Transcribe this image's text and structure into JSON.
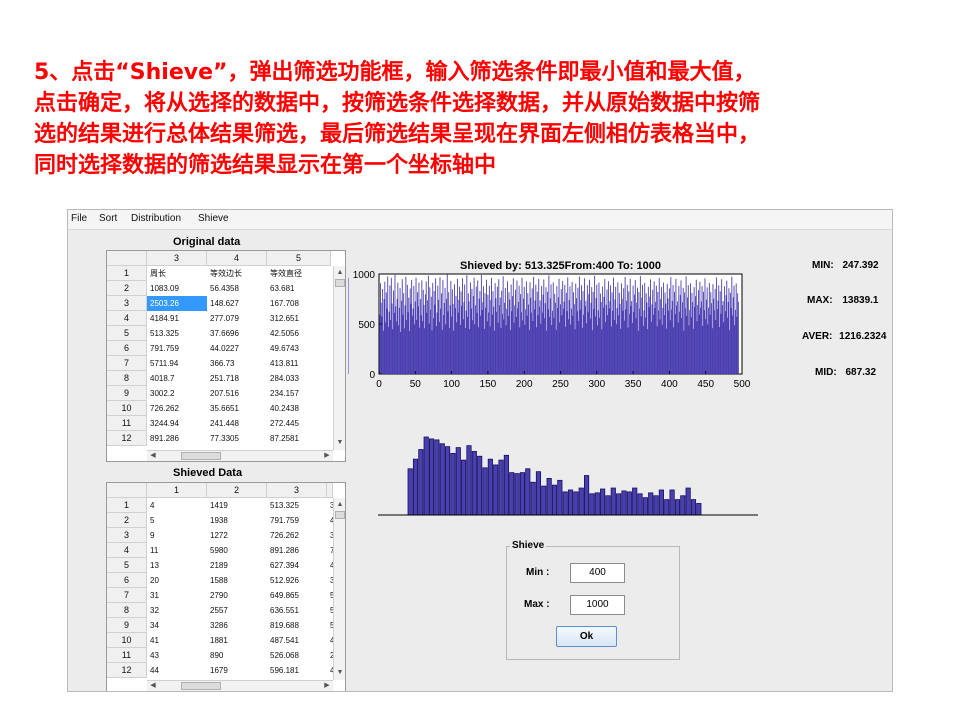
{
  "instruction": {
    "lines": [
      "5、点击“Shieve”，弹出筛选功能框，输入筛选条件即最小值和最大值，",
      "点击确定，将从选择的数据中，按筛选条件选择数据，并从原始数据中按筛",
      "选的结果进行总体结果筛选，最后筛选结果呈现在界面左侧相仿表格当中，",
      "同时选择数据的筛选结果显示在第一个坐标轴中"
    ]
  },
  "menu": [
    "File",
    "Sort",
    "Distribution",
    "Shieve"
  ],
  "original_table": {
    "label": "Original data",
    "columns": [
      "3",
      "4",
      "5"
    ],
    "rows": [
      {
        "n": "1",
        "c": [
          "周长",
          "等效边长",
          "等效直径"
        ]
      },
      {
        "n": "2",
        "c": [
          "1083.09",
          "56.4358",
          "63.681"
        ]
      },
      {
        "n": "3",
        "c": [
          "2503.26",
          "148.627",
          "167.708"
        ]
      },
      {
        "n": "4",
        "c": [
          "4184.91",
          "277.079",
          "312.651"
        ]
      },
      {
        "n": "5",
        "c": [
          "513.325",
          "37.6696",
          "42.5056"
        ]
      },
      {
        "n": "6",
        "c": [
          "791.759",
          "44.0227",
          "49.6743"
        ]
      },
      {
        "n": "7",
        "c": [
          "5711.94",
          "366.73",
          "413.811"
        ]
      },
      {
        "n": "8",
        "c": [
          "4018.7",
          "251.718",
          "284.033"
        ]
      },
      {
        "n": "9",
        "c": [
          "3002.2",
          "207.516",
          "234.157"
        ]
      },
      {
        "n": "10",
        "c": [
          "726.262",
          "35.6651",
          "40.2438"
        ]
      },
      {
        "n": "11",
        "c": [
          "3244.94",
          "241.448",
          "272.445"
        ]
      },
      {
        "n": "12",
        "c": [
          "891.286",
          "77.3305",
          "87.2581"
        ]
      }
    ],
    "selected": {
      "row": 2,
      "col": 0
    }
  },
  "shieved_table": {
    "label": "Shieved Data",
    "columns": [
      "1",
      "2",
      "3"
    ],
    "rows": [
      {
        "n": "1",
        "c": [
          "4",
          "1419",
          "513.325",
          "3"
        ]
      },
      {
        "n": "2",
        "c": [
          "5",
          "1938",
          "791.759",
          "4"
        ]
      },
      {
        "n": "3",
        "c": [
          "9",
          "1272",
          "726.262",
          "3"
        ]
      },
      {
        "n": "4",
        "c": [
          "11",
          "5980",
          "891.286",
          "7"
        ]
      },
      {
        "n": "5",
        "c": [
          "13",
          "2189",
          "627.394",
          "4"
        ]
      },
      {
        "n": "6",
        "c": [
          "20",
          "1588",
          "512.926",
          "3"
        ]
      },
      {
        "n": "7",
        "c": [
          "31",
          "2790",
          "649.865",
          "5"
        ]
      },
      {
        "n": "8",
        "c": [
          "32",
          "2557",
          "636.551",
          "5"
        ]
      },
      {
        "n": "9",
        "c": [
          "34",
          "3286",
          "819.688",
          "5"
        ]
      },
      {
        "n": "10",
        "c": [
          "41",
          "1881",
          "487.541",
          "4"
        ]
      },
      {
        "n": "11",
        "c": [
          "43",
          "890",
          "526.068",
          "2"
        ]
      },
      {
        "n": "12",
        "c": [
          "44",
          "1679",
          "596.181",
          "4"
        ]
      }
    ]
  },
  "stats": [
    {
      "label": "MIN:",
      "value": "247.392"
    },
    {
      "label": "MAX:",
      "value": "13839.1"
    },
    {
      "label": "AVER:",
      "value": "1216.2324"
    },
    {
      "label": "MID:",
      "value": "687.32"
    }
  ],
  "shieve_panel": {
    "title": "Shieve",
    "min_label": "Min :",
    "min_value": "400",
    "max_label": "Max :",
    "max_value": "1000",
    "ok_label": "Ok"
  },
  "colors": {
    "bar": "#4b3fb0",
    "bar_dark": "#1e1a6e",
    "instruction": "#ff0000",
    "selection": "#3399ff"
  },
  "chart_data": [
    {
      "type": "bar",
      "title": "Shieved by: 513.325From:400 To: 1000",
      "xlim": [
        0,
        500
      ],
      "ylim": [
        0,
        1000
      ],
      "xticks": [
        0,
        50,
        100,
        150,
        200,
        250,
        300,
        350,
        400,
        450,
        500
      ],
      "yticks": [
        0,
        500,
        1000
      ],
      "x": [
        1,
        2,
        3,
        4,
        5,
        6,
        7,
        8,
        9,
        10,
        11,
        12,
        13,
        14,
        15,
        16,
        17,
        18,
        19,
        20,
        21,
        22,
        23,
        24,
        25,
        26,
        27,
        28,
        29,
        30,
        31,
        32,
        33,
        34,
        35,
        36,
        37,
        38,
        39,
        40,
        41,
        42,
        43,
        44,
        45,
        46,
        47,
        48,
        49,
        50,
        51,
        52,
        53,
        54,
        55,
        56,
        57,
        58,
        59,
        60,
        61,
        62,
        63,
        64,
        65,
        66,
        67,
        68,
        69,
        70,
        71,
        72,
        73,
        74,
        75,
        76,
        77,
        78,
        79,
        80,
        81,
        82,
        83,
        84,
        85,
        86,
        87,
        88,
        89,
        90,
        91,
        92,
        93,
        94,
        95,
        96,
        97,
        98,
        99,
        100,
        101,
        102,
        103,
        104,
        105,
        106,
        107,
        108,
        109,
        110,
        111,
        112,
        113,
        114,
        115,
        116,
        117,
        118,
        119,
        120,
        121,
        122,
        123,
        124,
        125,
        126,
        127,
        128,
        129,
        130,
        131,
        132,
        133,
        134,
        135,
        136,
        137,
        138,
        139,
        140,
        141,
        142,
        143,
        144,
        145,
        146,
        147,
        148,
        149,
        150,
        151,
        152,
        153,
        154,
        155,
        156,
        157,
        158,
        159,
        160,
        161,
        162,
        163,
        164,
        165,
        166,
        167,
        168,
        169,
        170,
        171,
        172,
        173,
        174,
        175,
        176,
        177,
        178,
        179,
        180,
        181,
        182,
        183,
        184,
        185,
        186,
        187,
        188,
        189,
        190,
        191,
        192,
        193,
        194,
        195,
        196,
        197,
        198,
        199,
        200,
        201,
        202,
        203,
        204,
        205,
        206,
        207,
        208,
        209,
        210,
        211,
        212,
        213,
        214,
        215,
        216,
        217,
        218,
        219,
        220,
        221,
        222,
        223,
        224,
        225,
        226,
        227,
        228,
        229,
        230,
        231,
        232,
        233,
        234,
        235,
        236,
        237,
        238,
        239,
        240,
        241,
        242,
        243,
        244,
        245,
        246,
        247,
        248,
        249,
        250,
        251,
        252,
        253,
        254,
        255,
        256,
        257,
        258,
        259,
        260,
        261,
        262,
        263,
        264,
        265,
        266,
        267,
        268,
        269,
        270,
        271,
        272,
        273,
        274,
        275,
        276,
        277,
        278,
        279,
        280,
        281,
        282,
        283,
        284,
        285,
        286,
        287,
        288,
        289,
        290,
        291,
        292,
        293,
        294,
        295,
        296,
        297,
        298,
        299,
        300,
        301,
        302,
        303,
        304,
        305,
        306,
        307,
        308,
        309,
        310,
        311,
        312,
        313,
        314,
        315,
        316,
        317,
        318,
        319,
        320,
        321,
        322,
        323,
        324,
        325,
        326,
        327,
        328,
        329,
        330,
        331,
        332,
        333,
        334,
        335,
        336,
        337,
        338,
        339,
        340,
        341,
        342,
        343,
        344,
        345,
        346,
        347,
        348,
        349,
        350,
        351,
        352,
        353,
        354,
        355,
        356,
        357,
        358,
        359,
        360,
        361,
        362,
        363,
        364,
        365,
        366,
        367,
        368,
        369,
        370,
        371,
        372,
        373,
        374,
        375,
        376,
        377,
        378,
        379,
        380,
        381,
        382,
        383,
        384,
        385,
        386,
        387,
        388,
        389,
        390,
        391,
        392,
        393,
        394,
        395,
        396,
        397,
        398,
        399,
        400,
        401,
        402,
        403,
        404,
        405,
        406,
        407,
        408,
        409,
        410,
        411,
        412,
        413,
        414,
        415,
        416,
        417,
        418,
        419,
        420,
        421,
        422,
        423,
        424,
        425,
        426,
        427,
        428,
        429,
        430,
        431,
        432,
        433,
        434,
        435,
        436,
        437,
        438,
        439,
        440,
        441,
        442,
        443,
        444,
        445,
        446,
        447,
        448,
        449,
        450,
        451,
        452,
        453,
        454,
        455,
        456,
        457,
        458,
        459,
        460,
        461,
        462,
        463,
        464,
        465,
        466,
        467,
        468,
        469,
        470,
        471,
        472,
        473,
        474,
        475,
        476,
        477,
        478,
        479,
        480,
        481,
        482,
        483,
        484,
        485,
        486,
        487,
        488,
        489,
        490,
        491,
        492,
        493,
        494,
        495
      ],
      "values": [
        592,
        907,
        713,
        575,
        851,
        434,
        749,
        923,
        517,
        816,
        652,
        976,
        471,
        623,
        886,
        540,
        961,
        705,
        448,
        835,
        612,
        991,
        678,
        527,
        752,
        914,
        486,
        663,
        859,
        421,
        733,
        948,
        594,
        809,
        456,
        687,
        972,
        538,
        891,
        617,
        763,
        429,
        855,
        702,
        941,
        583,
        654,
        881,
        497,
        726,
        963,
        542,
        818,
        676,
        914,
        463,
        749,
        587,
        937,
        528,
        842,
        691,
        458,
        796,
        925,
        612,
        737,
        984,
        504,
        867,
        641,
        773,
        436,
        912,
        558,
        829,
        694,
        957,
        478,
        615,
        883,
        742,
        521,
        968,
        654,
        807,
        441,
        939,
        589,
        711,
        862,
        497,
        753,
        994,
        626,
        818,
        462,
        687,
        931,
        574,
        846,
        702,
        433,
        897,
        659,
        781,
        518,
        952,
        614,
        741,
        873,
        492,
        826,
        683,
        958,
        547,
        719,
        895,
        461,
        634,
        988,
        572,
        807,
        726,
        449,
        916,
        653,
        851,
        538,
        779,
        962,
        497,
        687,
        874,
        612,
        936,
        468,
        754,
        829,
        583,
        991,
        641,
        718,
        877,
        452,
        806,
        663,
        943,
        527,
        792,
        615,
        882,
        476,
        739,
        961,
        594,
        827,
        672,
        435,
        908,
        756,
        621,
        873,
        511,
        948,
        689,
        764,
        459,
        834,
        602,
        977,
        546,
        713,
        861,
        487,
        652,
        926,
        579,
        818,
        744,
        439,
        895,
        628,
        779,
        957,
        513,
        686,
        842,
        571,
        934,
        657,
        721,
        884,
        466,
        799,
        617,
        963,
        536,
        752,
        871,
        492,
        647,
        926,
        583,
        808,
        695,
        441,
        917,
        763,
        614,
        856,
        529,
        972,
        648,
        735,
        893,
        467,
        824,
        589,
        951,
        673,
        736,
        502,
        881,
        614,
        793,
        945,
        558,
        709,
        867,
        434,
        823,
        647,
        986,
        571,
        756,
        896,
        489,
        632,
        917,
        557,
        802,
        714,
        443,
        879,
        661,
        768,
        952,
        516,
        697,
        848,
        587,
        931,
        652,
        724,
        891,
        472,
        813,
        629,
        967,
        548,
        741,
        876,
        495,
        654,
        921,
        583,
        817,
        698,
        448,
        904,
        759,
        627,
        862,
        531,
        975,
        643,
        738,
        887,
        461,
        829,
        594,
        956,
        677,
        732,
        508,
        888,
        617,
        797,
        942,
        553,
        712,
        869,
        437,
        821,
        651,
        983,
        574,
        759,
        893,
        486,
        637,
        914,
        561,
        804,
        719,
        446,
        875,
        664,
        771,
        949,
        519,
        693,
        845,
        589,
        928,
        655,
        727,
        887,
        475,
        816,
        633,
        964,
        542,
        746,
        872,
        498,
        658,
        917,
        586,
        812,
        701,
        452,
        906,
        752,
        631,
        858,
        534,
        971,
        647,
        734,
        892,
        464,
        826,
        597,
        953,
        681,
        729,
        511,
        884,
        621,
        794,
        939,
        556,
        715,
        864,
        431,
        819,
        654,
        979,
        577,
        762,
        891,
        483,
        635,
        911,
        564,
        807,
        716,
        449,
        872,
        668,
        774,
        946,
        523,
        697,
        842,
        591,
        925,
        659,
        722,
        883,
        478,
        819,
        636,
        961,
        545,
        749,
        869,
        494,
        661,
        914,
        589,
        815,
        704,
        455,
        901,
        756,
        634,
        855,
        537,
        968,
        645,
        731,
        889,
        467,
        823,
        599,
        951,
        684,
        726,
        514,
        881,
        624,
        791,
        936,
        559,
        718,
        861,
        434,
        816,
        657,
        976,
        581,
        765,
        888,
        486,
        638,
        908,
        567,
        811,
        719,
        452,
        869,
        671,
        777,
        943,
        526,
        691,
        839,
        594,
        922,
        662,
        725,
        879,
        481,
        822,
        639,
        958,
        549,
        744,
        866,
        497,
        664,
        911,
        592,
        818,
        707,
        458,
        898,
        753,
        637,
        852,
        541,
        965,
        648,
        734,
        886,
        469,
        827,
        602,
        948,
        687,
        729,
        517,
        878,
        627,
        787,
        933,
        562,
        721,
        858,
        438,
        813,
        659,
        973,
        584,
        767,
        885,
        489,
        641,
        905,
        571,
        808,
        722,
        455,
        866,
        674,
        779,
        939,
        529,
        694,
        836,
        597,
        919,
        665,
        728,
        876,
        484,
        825,
        642,
        955,
        552,
        747,
        863,
        499,
        667,
        908,
        595,
        821,
        711,
        461,
        895,
        757,
        640,
        849,
        544,
        962,
        651,
        737,
        883,
        472,
        831,
        605,
        945
      ],
      "color": "#4b3fb0"
    },
    {
      "type": "bar",
      "values": [
        48,
        58,
        68,
        81,
        79,
        78,
        74,
        71,
        64,
        70,
        57,
        72,
        66,
        61,
        49,
        58,
        52,
        57,
        62,
        44,
        43,
        44,
        48,
        34,
        45,
        30,
        38,
        31,
        36,
        24,
        26,
        24,
        28,
        41,
        22,
        23,
        27,
        20,
        28,
        22,
        25,
        24,
        28,
        22,
        18,
        23,
        20,
        26,
        16,
        26,
        16,
        20,
        28,
        16,
        12
      ],
      "color": "#4b3fb0"
    }
  ]
}
